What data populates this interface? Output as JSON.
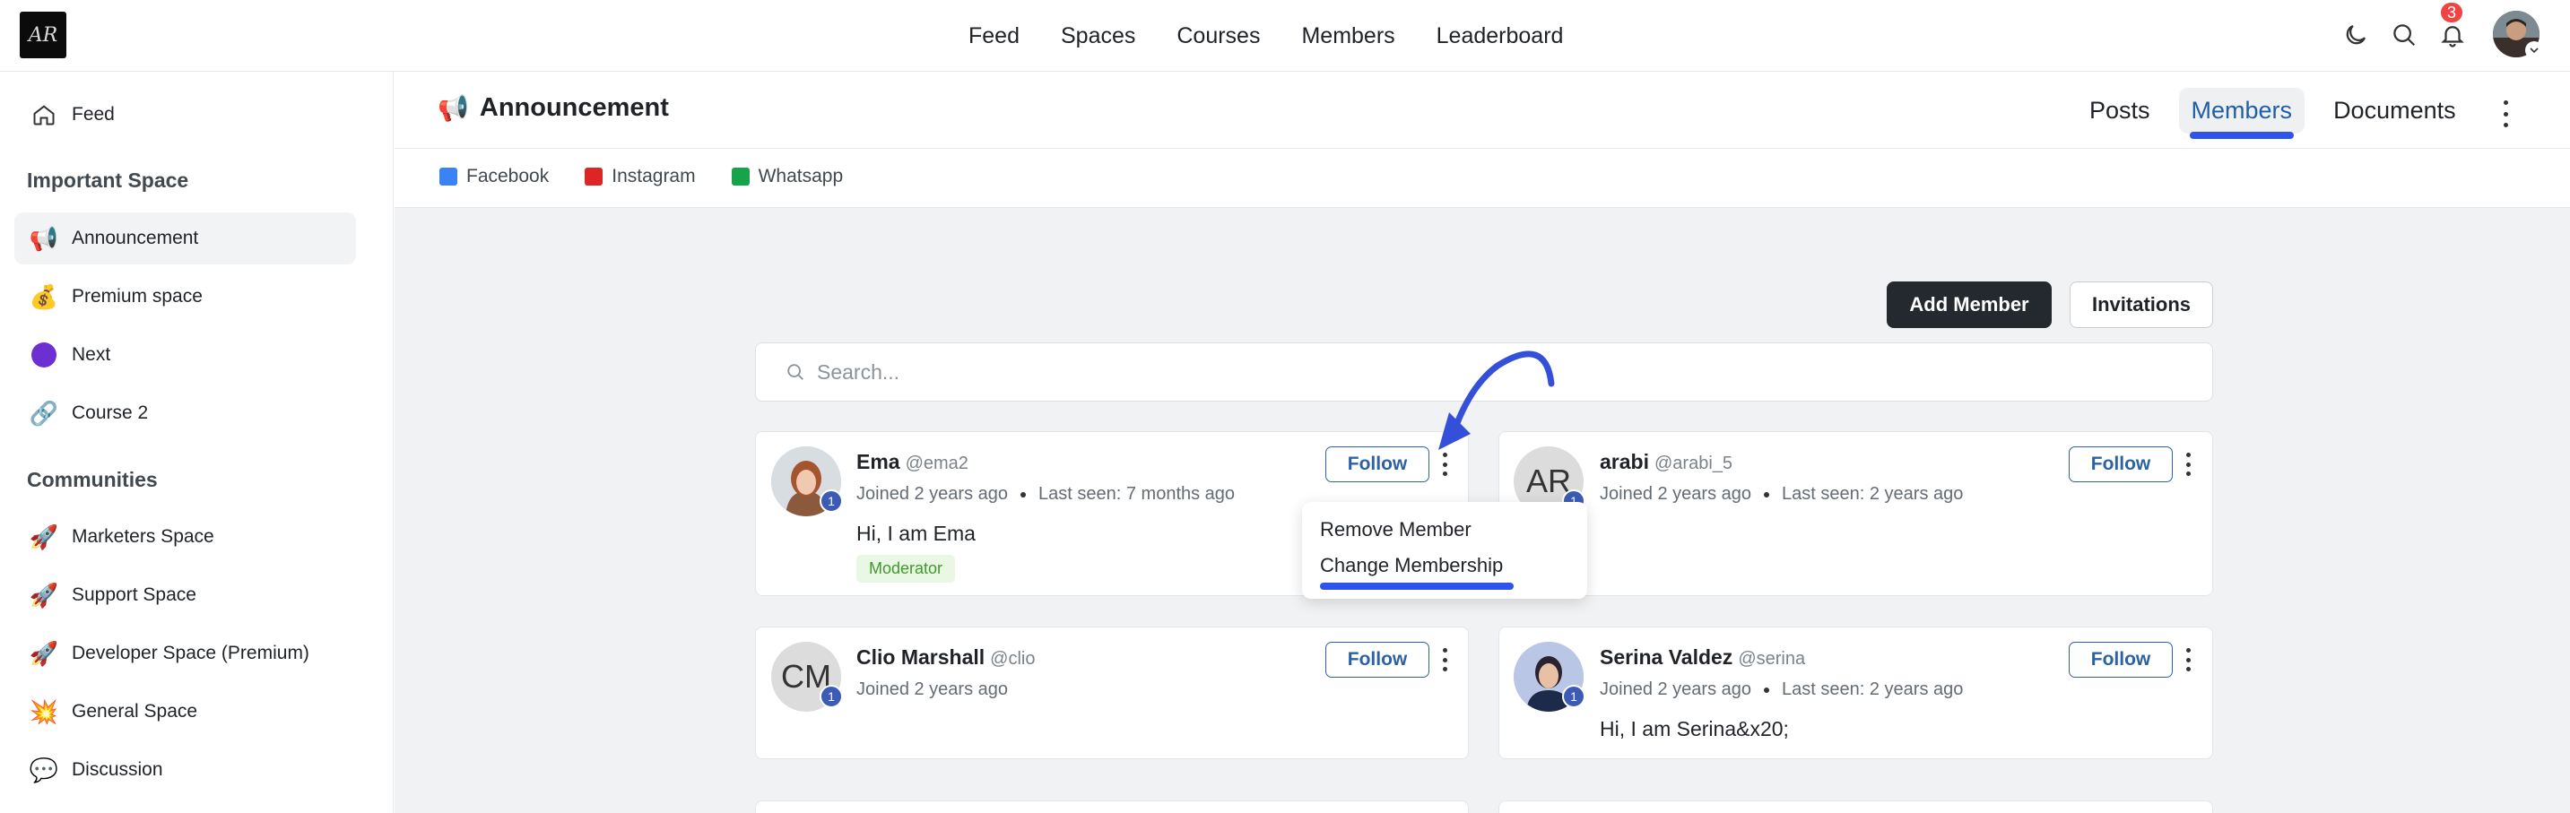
{
  "topbar": {
    "logo_text": "AR",
    "nav": [
      "Feed",
      "Spaces",
      "Courses",
      "Members",
      "Leaderboard"
    ],
    "notification_count": "3",
    "icons": [
      "moon-icon",
      "search-icon",
      "bell-icon"
    ]
  },
  "sidebar": {
    "feed": {
      "label": "Feed",
      "icon": "home-icon"
    },
    "section1": "Important Space",
    "section1_items": [
      {
        "label": "Announcement",
        "icon": "megaphone-icon",
        "emoji": "📢"
      },
      {
        "label": "Premium space",
        "icon": "money-bag-icon",
        "emoji": "💰"
      },
      {
        "label": "Next",
        "icon": "purple-circle-icon",
        "emoji": ""
      },
      {
        "label": "Course 2",
        "icon": "link-icon",
        "emoji": "🔗"
      }
    ],
    "section2": "Communities",
    "section2_items": [
      {
        "label": "Marketers Space",
        "icon": "rocket-icon",
        "emoji": "🚀"
      },
      {
        "label": "Support Space",
        "icon": "rocket-icon",
        "emoji": "🚀"
      },
      {
        "label": "Developer Space (Premium)",
        "icon": "rocket-icon",
        "emoji": "🚀"
      },
      {
        "label": "General Space",
        "icon": "collision-icon",
        "emoji": "💥"
      },
      {
        "label": "Discussion",
        "icon": "speech-bubble-icon",
        "emoji": "💬"
      }
    ]
  },
  "header": {
    "title": "Announcement",
    "title_emoji": "📢",
    "tabs": [
      "Posts",
      "Members",
      "Documents"
    ],
    "links": [
      {
        "label": "Facebook",
        "color": "#3b82f6"
      },
      {
        "label": "Instagram",
        "color": "#dc2626"
      },
      {
        "label": "Whatsapp",
        "color": "#16a34a"
      }
    ]
  },
  "actions": {
    "add_member": "Add Member",
    "invitations": "Invitations"
  },
  "search": {
    "placeholder": "Search..."
  },
  "follow_label": "Follow",
  "members": [
    {
      "name": "Ema",
      "handle": "@ema2",
      "joined": "Joined 2 years ago",
      "last_seen": "Last seen: 7 months ago",
      "bio": "Hi, I am Ema",
      "tag": "Moderator",
      "level": "1",
      "initials": ""
    },
    {
      "name": "arabi",
      "handle": "@arabi_5",
      "joined": "Joined 2 years ago",
      "last_seen": "Last seen: 2 years ago",
      "bio": "",
      "tag": "",
      "level": "1",
      "initials": "AR"
    },
    {
      "name": "Clio Marshall",
      "handle": "@clio",
      "joined": "Joined 2 years ago",
      "last_seen": "",
      "bio": "",
      "tag": "",
      "level": "1",
      "initials": "CM"
    },
    {
      "name": "Serina Valdez",
      "handle": "@serina",
      "joined": "Joined 2 years ago",
      "last_seen": "Last seen: 2 years ago",
      "bio": "Hi, I am Serina&x20;",
      "tag": "",
      "level": "1",
      "initials": ""
    }
  ],
  "menu": {
    "remove": "Remove Member",
    "change": "Change Membership"
  },
  "colors": {
    "accent": "#2f54eb",
    "link": "#2b62a3",
    "dark_button": "#24292f"
  }
}
